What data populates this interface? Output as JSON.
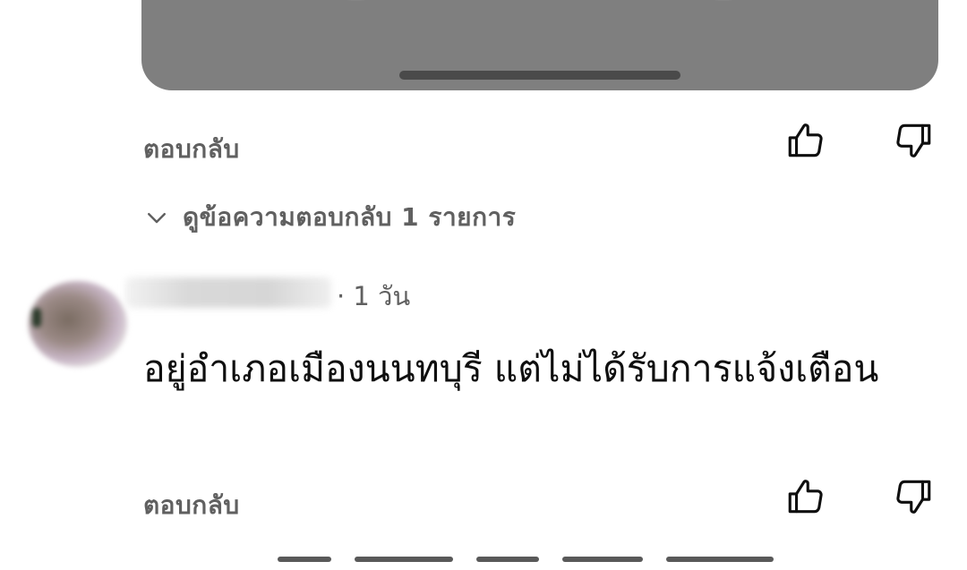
{
  "previous_comment": {
    "reply_label": "ตอบกลับ",
    "like_icon": "thumbs-up-icon",
    "dislike_icon": "thumbs-down-icon",
    "view_replies_icon": "chevron-down-icon",
    "view_replies_label": "ดูข้อความตอบกลับ 1 รายการ"
  },
  "comment": {
    "meta": "· 1 วัน",
    "text": "อยู่อำเภอเมืองนนทบุรี แต่ไม่ได้รับการแจ้งเตือน",
    "reply_label": "ตอบกลับ",
    "like_icon": "thumbs-up-icon",
    "dislike_icon": "thumbs-down-icon"
  },
  "colors": {
    "media_card": "#7f7f7f",
    "secondary_text": "#606060",
    "primary_text": "#0f0f0f"
  }
}
